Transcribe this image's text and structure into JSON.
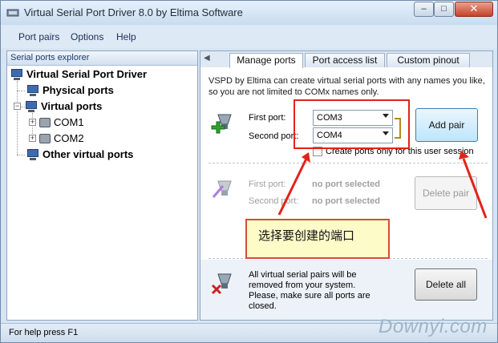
{
  "window": {
    "title": "Virtual Serial Port Driver 8.0 by Eltima Software"
  },
  "menu": [
    "Port pairs",
    "Options",
    "Help"
  ],
  "explorer": {
    "header": "Serial ports explorer",
    "root": "Virtual Serial Port Driver",
    "physical": "Physical ports",
    "virtual": "Virtual ports",
    "ports": [
      "COM1",
      "COM2"
    ],
    "other": "Other virtual ports"
  },
  "tabs": [
    "Manage ports",
    "Port access list",
    "Custom pinout"
  ],
  "manage": {
    "description": "VSPD by Eltima can create virtual serial ports with any names you like, so you are not limited to COMx names only.",
    "first_port_label": "First port:",
    "second_port_label": "Second port:",
    "first_port_value": "COM3",
    "second_port_value": "COM4",
    "add_pair": "Add pair",
    "user_session_checkbox": "Create ports only for this user session",
    "user_session_checked": false
  },
  "delete_section": {
    "first_port_label": "First port:",
    "second_port_label": "Second port:",
    "first_port_value": "no port selected",
    "second_port_value": "no port selected",
    "delete_pair": "Delete pair"
  },
  "delete_all_section": {
    "note": "All virtual serial pairs will be removed from your system. Please, make sure all ports are closed.",
    "delete_all": "Delete all"
  },
  "status": "For help press F1",
  "annotation": {
    "callout": "选择要创建的端口"
  },
  "watermark": "Downyi.com",
  "colors": {
    "accent": "#3c7fb1",
    "annotation_red": "#e2231a",
    "callout_bg": "#fdfbc8"
  }
}
